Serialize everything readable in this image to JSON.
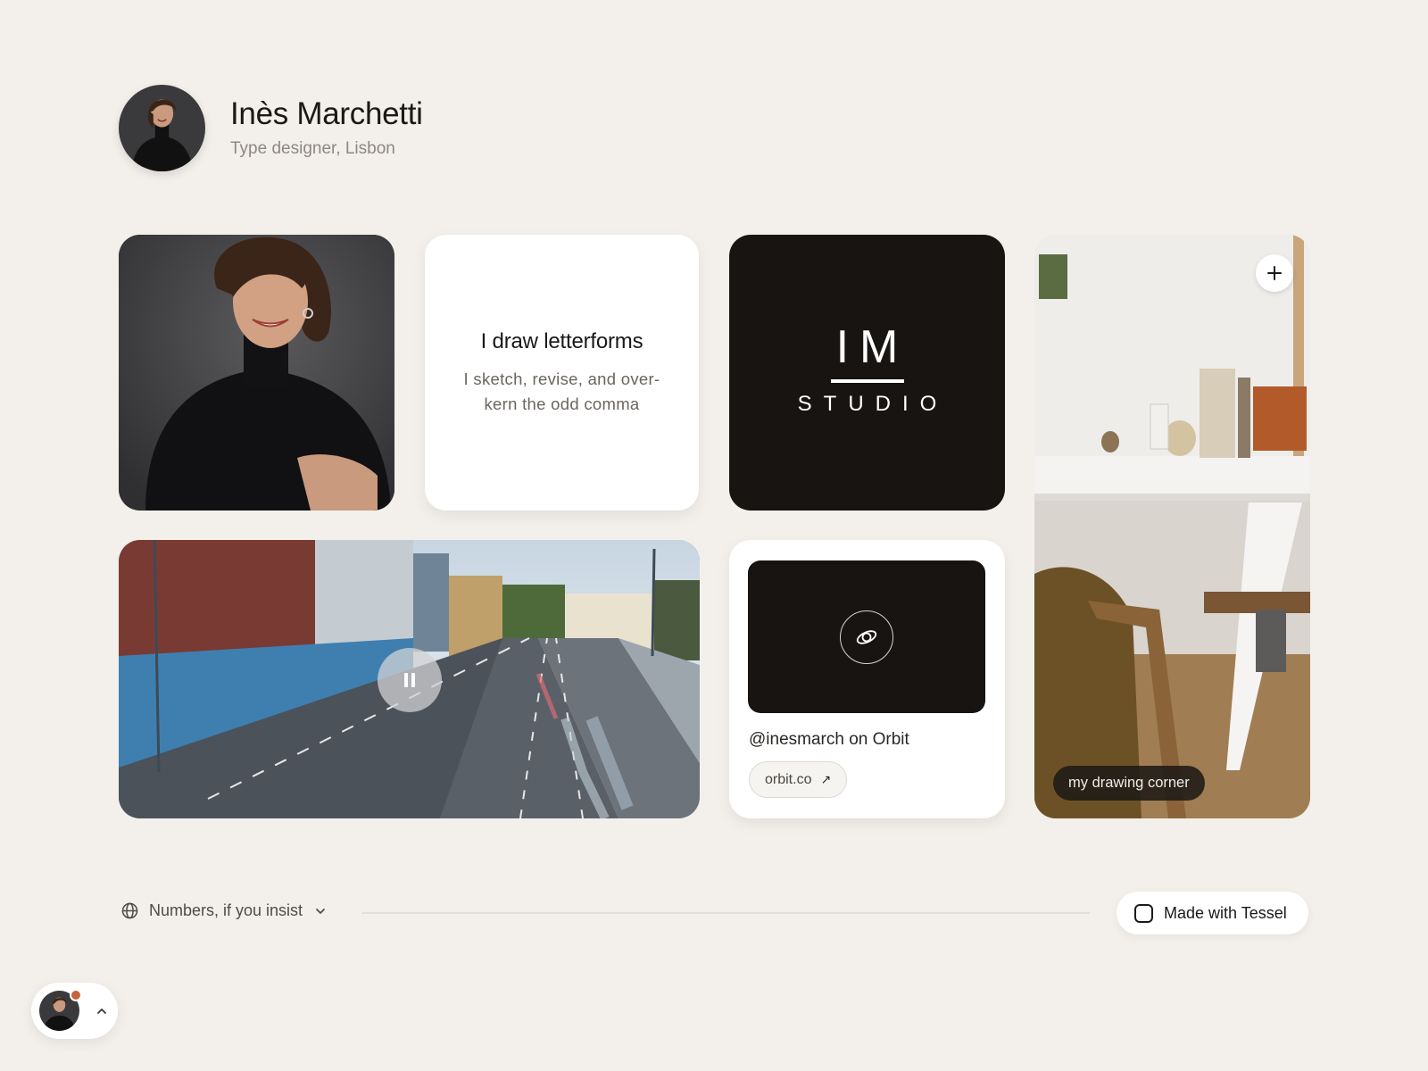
{
  "profile": {
    "name": "Inès Marchetti",
    "subtitle": "Type designer, Lisbon",
    "avatar_icon": "portrait-avatar"
  },
  "tiles": {
    "text_card": {
      "title": "I draw letterforms",
      "body": "I sketch, revise, and over-kern the odd comma"
    },
    "logo_card": {
      "monogram": "IM",
      "wordmark": "STUDIO"
    },
    "room_card": {
      "caption": "my drawing corner",
      "add_icon": "plus-icon"
    },
    "video_card": {
      "control_icon": "pause-icon"
    },
    "orbit_card": {
      "handle": "@inesmarch on Orbit",
      "link_label": "orbit.co",
      "link_icon": "arrow-up-right-icon",
      "cover_icon": "orbit-icon"
    }
  },
  "footer": {
    "language_label": "Numbers, if you insist",
    "language_icon": "globe-icon",
    "badge_label": "Made with Tessel"
  },
  "colors": {
    "background": "#f3f0eb",
    "ink": "#171412",
    "notification_dot": "#c6643d"
  }
}
